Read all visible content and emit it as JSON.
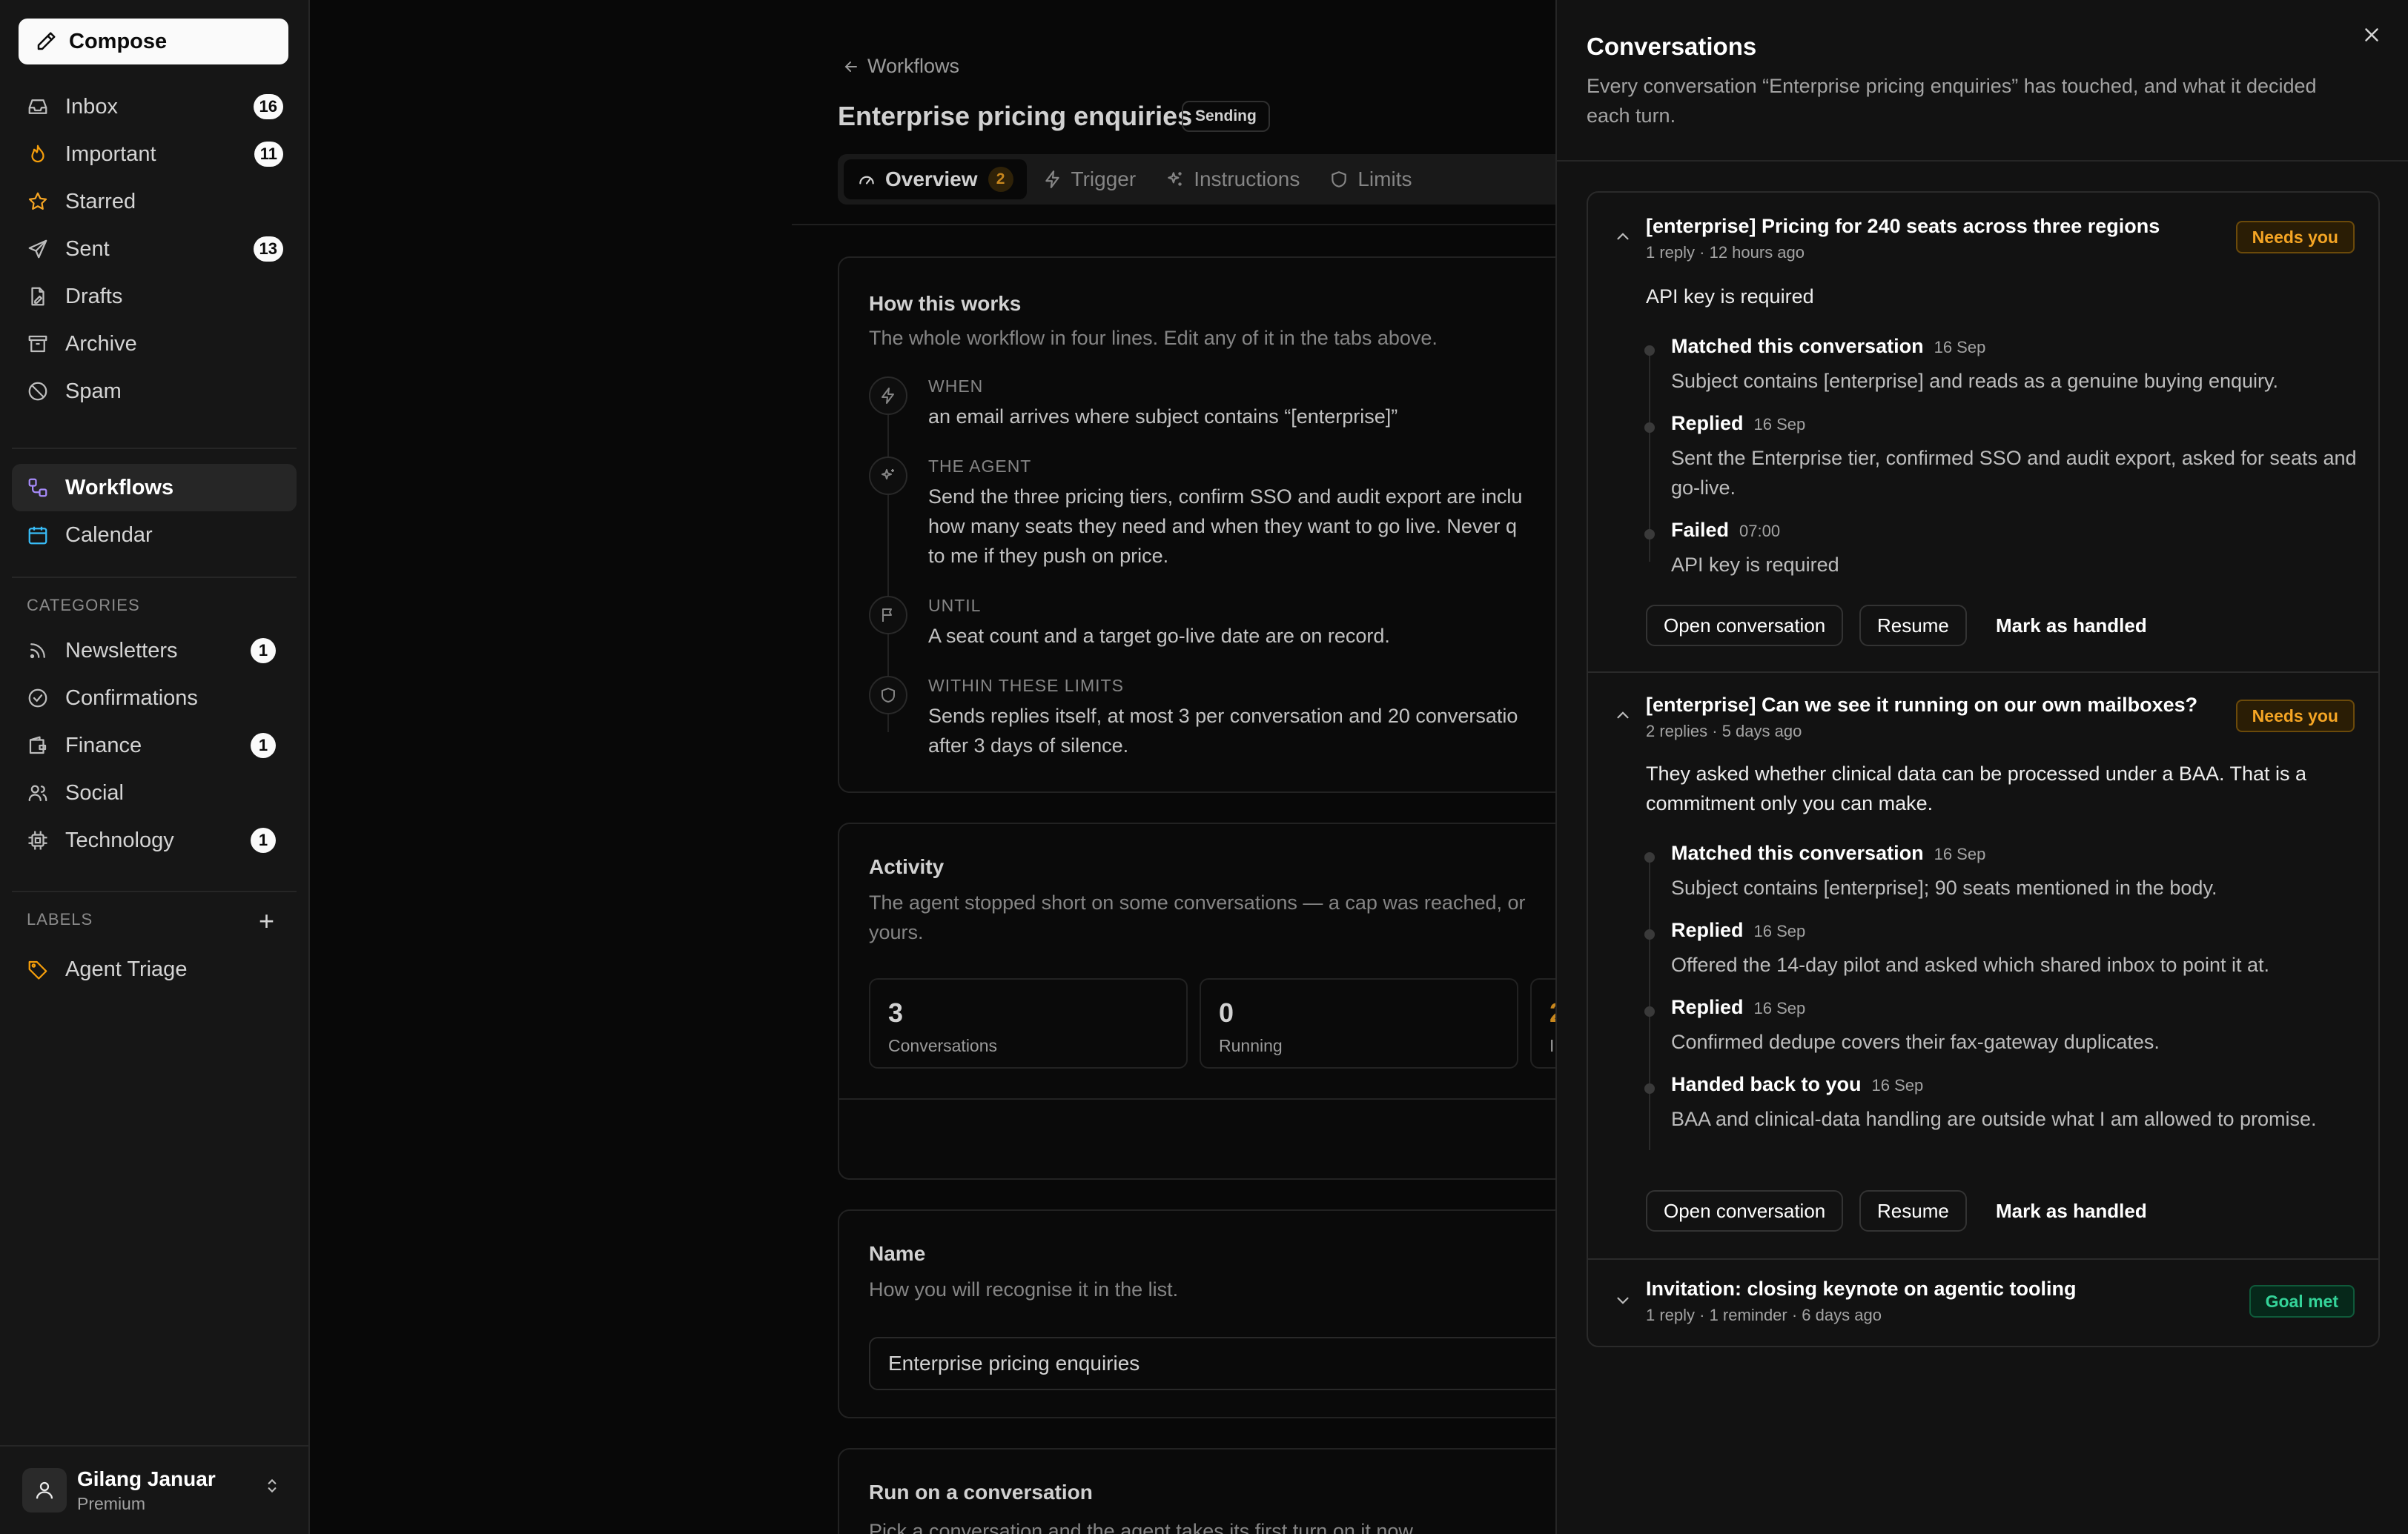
{
  "sidebar": {
    "compose": "Compose",
    "nav": [
      {
        "label": "Inbox",
        "count": "16"
      },
      {
        "label": "Important",
        "count": "11"
      },
      {
        "label": "Starred"
      },
      {
        "label": "Sent",
        "count": "13"
      },
      {
        "label": "Drafts"
      },
      {
        "label": "Archive"
      },
      {
        "label": "Spam"
      }
    ],
    "apps": [
      {
        "label": "Workflows",
        "active": true
      },
      {
        "label": "Calendar"
      }
    ],
    "categories_label": "CATEGORIES",
    "categories": [
      {
        "label": "Newsletters",
        "count": "1"
      },
      {
        "label": "Confirmations"
      },
      {
        "label": "Finance",
        "count": "1"
      },
      {
        "label": "Social"
      },
      {
        "label": "Technology",
        "count": "1"
      }
    ],
    "labels_label": "LABELS",
    "add_label": "+",
    "labels": [
      {
        "label": "Agent Triage"
      }
    ],
    "user": {
      "name": "Gilang Januar",
      "plan": "Premium"
    }
  },
  "main": {
    "back": "Workflows",
    "title": "Enterprise pricing enquiries",
    "status": "Sending",
    "tabs": [
      {
        "label": "Overview",
        "badge": "2",
        "active": true
      },
      {
        "label": "Trigger"
      },
      {
        "label": "Instructions"
      },
      {
        "label": "Limits"
      }
    ],
    "how": {
      "title": "How this works",
      "sub": "The whole workflow in four lines. Edit any of it in the tabs above.",
      "steps": [
        {
          "label": "WHEN",
          "text": [
            "an email arrives where subject contains “[enterprise]”"
          ]
        },
        {
          "label": "THE AGENT",
          "text": [
            "Send the three pricing tiers, confirm SSO and audit export are inclu",
            "how many seats they need and when they want to go live. Never q",
            "to me if they push on price."
          ]
        },
        {
          "label": "UNTIL",
          "text": [
            "A seat count and a target go-live date are on record."
          ]
        },
        {
          "label": "WITHIN THESE LIMITS",
          "text": [
            "Sends replies itself, at most 3 per conversation and 20 conversatio",
            "after 3 days of silence."
          ]
        }
      ]
    },
    "activity": {
      "title": "Activity",
      "sub": [
        "The agent stopped short on some conversations — a cap was reached, or",
        "yours."
      ],
      "stats": [
        {
          "num": "3",
          "label": "Conversations"
        },
        {
          "num": "0",
          "label": "Running"
        },
        {
          "num": "2",
          "label": "I"
        }
      ]
    },
    "name_card": {
      "title": "Name",
      "sub": "How you will recognise it in the list.",
      "value": "Enterprise pricing enquiries"
    },
    "run_card": {
      "title": "Run on a conversation",
      "sub": "Pick a conversation and the agent takes its first turn on it now."
    }
  },
  "drawer": {
    "title": "Conversations",
    "sub": "Every conversation “Enterprise pricing enquiries” has touched, and what it decided each turn.",
    "conversations": [
      {
        "title": "[enterprise] Pricing for 240 seats across three regions",
        "meta": "1 reply · 12 hours ago",
        "badge": "Needs you",
        "lead": "API key is required",
        "events": [
          {
            "head": "Matched this conversation",
            "date": "16 Sep",
            "text": "Subject contains [enterprise] and reads as a genuine buying enquiry."
          },
          {
            "head": "Replied",
            "date": "16 Sep",
            "text": "Sent the Enterprise tier, confirmed SSO and audit export, asked for seats and go-live."
          },
          {
            "head": "Failed",
            "date": "07:00",
            "text": "API key is required"
          }
        ],
        "actions": [
          "Open conversation",
          "Resume",
          "Mark as handled"
        ]
      },
      {
        "title": "[enterprise] Can we see it running on our own mailboxes?",
        "meta": "2 replies · 5 days ago",
        "badge": "Needs you",
        "lead": "They asked whether clinical data can be processed under a BAA. That is a commitment only you can make.",
        "events": [
          {
            "head": "Matched this conversation",
            "date": "16 Sep",
            "text": "Subject contains [enterprise]; 90 seats mentioned in the body."
          },
          {
            "head": "Replied",
            "date": "16 Sep",
            "text": "Offered the 14-day pilot and asked which shared inbox to point it at."
          },
          {
            "head": "Replied",
            "date": "16 Sep",
            "text": "Confirmed dedupe covers their fax-gateway duplicates."
          },
          {
            "head": "Handed back to you",
            "date": "16 Sep",
            "text": "BAA and clinical-data handling are outside what I am allowed to promise."
          }
        ],
        "actions": [
          "Open conversation",
          "Resume",
          "Mark as handled"
        ]
      },
      {
        "title": "Invitation: closing keynote on agentic tooling",
        "meta": "1 reply · 1 reminder · 6 days ago",
        "badge": "Goal met"
      }
    ]
  },
  "colors": {
    "accent": "#a78bfa",
    "warning": "#f5a524",
    "success": "#34d399",
    "calendar": "#38bdf8",
    "label": "#f59e0b"
  }
}
